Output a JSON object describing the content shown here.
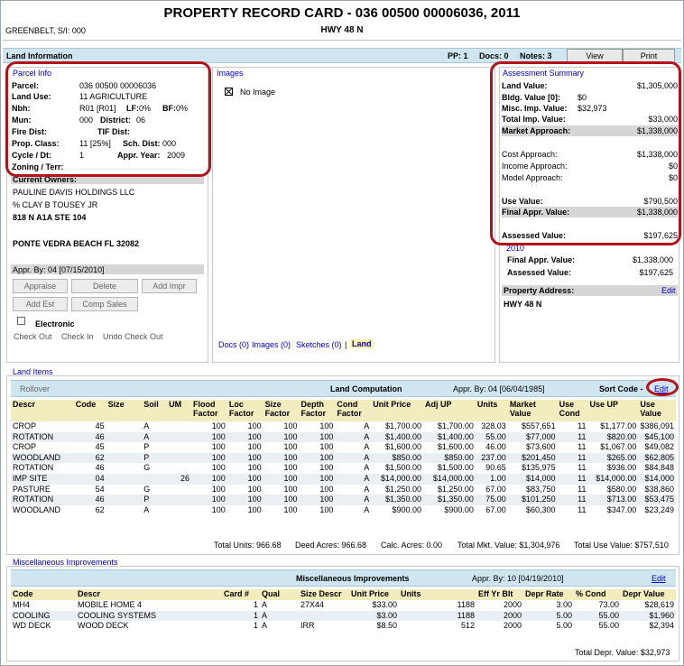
{
  "header": {
    "title": "PROPERTY RECORD CARD - 036 00500 00006036, 2011",
    "subtitle": "HWY 48 N",
    "owner_short": "GREENBELT, S/I: 000"
  },
  "land_info_bar": {
    "label": "Land Information",
    "pp": "PP: 1",
    "docs": "Docs: 0",
    "notes": "Notes: 3",
    "view_button": "View",
    "print_button": "Print"
  },
  "parcel_info": {
    "title": "Parcel Info",
    "parcel_label": "Parcel:",
    "parcel": "036 00500 00006036",
    "land_use_label": "Land Use:",
    "land_use": "11 AGRICULTURE",
    "nbh_label": "Nbh:",
    "nbh": "R01  [R01]",
    "lf_label": "LF:",
    "lf": "0%",
    "bf_label": "BF:",
    "bf": "0%",
    "mun_label": "Mun:",
    "mun": "000",
    "district_label": "District:",
    "district": "06",
    "fire_label": "Fire Dist:",
    "tif_label": "TIF Dist:",
    "prop_class_label": "Prop. Class:",
    "prop_class": "11  [25%]",
    "sch_label": "Sch. Dist:",
    "sch": "000",
    "cycle_label": "Cycle / Dt:",
    "cycle": "1",
    "appr_year_label": "Appr. Year:",
    "appr_year": "2009",
    "zoning_label": "Zoning / Terr:"
  },
  "owners": {
    "title": "Current Owners:",
    "line1": "PAULINE DAVIS HOLDINGS LLC",
    "line2": "% CLAY B TOUSEY JR",
    "line3": "818 N A1A STE 104",
    "line4": "PONTE VEDRA BEACH FL 32082",
    "appr_by": "Appr. By: 04 [07/15/2010]",
    "appraise": "Appraise",
    "delete": "Delete",
    "add_impr": "Add Impr",
    "add_est": "Add Est",
    "comp_sales": "Comp Sales",
    "electronic": "Electronic",
    "check_out": "Check Out",
    "check_in": "Check In",
    "undo_check_out": "Undo Check Out"
  },
  "images": {
    "title": "Images",
    "no_image": "No Image",
    "docs_link": "Docs (0)",
    "images_link": "Images (0)",
    "sketches_link": "Sketches (0)",
    "sep": "|",
    "land_link": "Land"
  },
  "assessment": {
    "title": "Assessment Summary",
    "land_value_label": "Land Value:",
    "land_value": "$1,305,000",
    "bldg_label": "Bldg. Value [0]:",
    "bldg": "$0",
    "misc_label": "Misc. Imp. Value:",
    "misc": "$32,973",
    "total_imp_label": "Total Imp. Value:",
    "total_imp": "$33,000",
    "market_label": "Market Approach:",
    "market": "$1,338,000",
    "cost_label": "Cost Approach:",
    "cost": "$1,338,000",
    "income_label": "Income Approach:",
    "income": "$0",
    "model_label": "Model Approach:",
    "model": "$0",
    "use_label": "Use Value:",
    "use": "$790,500",
    "final_label": "Final Appr. Value:",
    "final": "$1,338,000",
    "assessed_label": "Assessed Value:",
    "assessed": "$197,625",
    "prior_year": "2010",
    "prior_final_label": "Final Appr. Value:",
    "prior_final": "$1,338,000",
    "prior_assessed_label": "Assessed Value:",
    "prior_assessed": "$197,625",
    "address_label": "Property Address:",
    "address_edit": "Edit",
    "address": "HWY 48 N"
  },
  "land_items": {
    "title": "Land Items",
    "rollover": "Rollover",
    "computation": "Land Computation",
    "appr_by": "Appr. By: 04 [06/04/1985]",
    "sort_code": "Sort Code -",
    "edit": "Edit",
    "columns": [
      "Descr",
      "Code",
      "Size",
      "Soil",
      "UM",
      "Flood Factor",
      "Loc Factor",
      "Size Factor",
      "Depth Factor",
      "Cond Factor",
      "Unit Price",
      "Adj UP",
      "Units",
      "Market Value",
      "Use Cond",
      "Use UP",
      "Use Value"
    ],
    "rows": [
      [
        "CROP",
        "45",
        "",
        "A",
        "",
        "100",
        "100",
        "100",
        "100",
        "A",
        "$1,700.00",
        "$1,700.00",
        "328.03",
        "$557,651",
        "11",
        "$1,177.00",
        "$386,091"
      ],
      [
        "ROTATION",
        "46",
        "",
        "A",
        "",
        "100",
        "100",
        "100",
        "100",
        "A",
        "$1,400.00",
        "$1,400.00",
        "55.00",
        "$77,000",
        "11",
        "$820.00",
        "$45,100"
      ],
      [
        "CROP",
        "45",
        "",
        "P",
        "",
        "100",
        "100",
        "100",
        "100",
        "A",
        "$1,600.00",
        "$1,600.00",
        "46.00",
        "$73,600",
        "11",
        "$1,067.00",
        "$49,082"
      ],
      [
        "WOODLAND",
        "62",
        "",
        "P",
        "",
        "100",
        "100",
        "100",
        "100",
        "A",
        "$850.00",
        "$850.00",
        "237.00",
        "$201,450",
        "11",
        "$265.00",
        "$62,805"
      ],
      [
        "ROTATION",
        "46",
        "",
        "G",
        "",
        "100",
        "100",
        "100",
        "100",
        "A",
        "$1,500.00",
        "$1,500.00",
        "90.65",
        "$135,975",
        "11",
        "$936.00",
        "$84,848"
      ],
      [
        "IMP SITE",
        "04",
        "",
        "",
        "26",
        "100",
        "100",
        "100",
        "100",
        "A",
        "$14,000.00",
        "$14,000.00",
        "1.00",
        "$14,000",
        "11",
        "$14,000.00",
        "$14,000"
      ],
      [
        "PASTURE",
        "54",
        "",
        "G",
        "",
        "100",
        "100",
        "100",
        "100",
        "A",
        "$1,250.00",
        "$1,250.00",
        "67.00",
        "$83,750",
        "11",
        "$580.00",
        "$38,860"
      ],
      [
        "ROTATION",
        "46",
        "",
        "P",
        "",
        "100",
        "100",
        "100",
        "100",
        "A",
        "$1,350.00",
        "$1,350.00",
        "75.00",
        "$101,250",
        "11",
        "$713.00",
        "$53,475"
      ],
      [
        "WOODLAND",
        "62",
        "",
        "A",
        "",
        "100",
        "100",
        "100",
        "100",
        "A",
        "$900.00",
        "$900.00",
        "67.00",
        "$60,300",
        "11",
        "$347.00",
        "$23,249"
      ]
    ],
    "totals": {
      "units": "Total Units: 966.68",
      "deed": "Deed Acres: 966.68",
      "calc": "Calc. Acres: 0.00",
      "mkt": "Total Mkt. Value: $1,304,976",
      "use": "Total Use Value: $757,510"
    }
  },
  "misc_impr": {
    "title": "Miscellaneous Improvements",
    "bar_title": "Miscellaneous Improvements",
    "appr_by": "Appr. By: 10 [04/19/2010]",
    "edit": "Edit",
    "columns": [
      "Code",
      "Descr",
      "Card #",
      "Qual",
      "Size Descr",
      "Unit Price",
      "Units",
      "Eff Yr Blt",
      "Depr Rate",
      "% Cond",
      "Depr Value"
    ],
    "rows": [
      [
        "MH4",
        "MOBILE HOME 4",
        "1",
        "A",
        "27X44",
        "$33.00",
        "1188",
        "2000",
        "3.00",
        "73.00",
        "$28,619"
      ],
      [
        "COOLING",
        "COOLING SYSTEMS",
        "1",
        "A",
        "",
        "$3.00",
        "1188",
        "2000",
        "5.00",
        "55.00",
        "$1,960"
      ],
      [
        "WD DECK",
        "WOOD DECK",
        "1",
        "A",
        "IRR",
        "$8.50",
        "512",
        "2000",
        "5.00",
        "55.00",
        "$2,394"
      ]
    ],
    "total": "Total Depr. Value: $32,973"
  },
  "colors": {
    "bar": "#cfe6f0",
    "table_header": "#f3ecbf",
    "highlight_row": "#d6d6d6",
    "annotation_red": "#b3121b",
    "link_blue": "#0000cc"
  }
}
